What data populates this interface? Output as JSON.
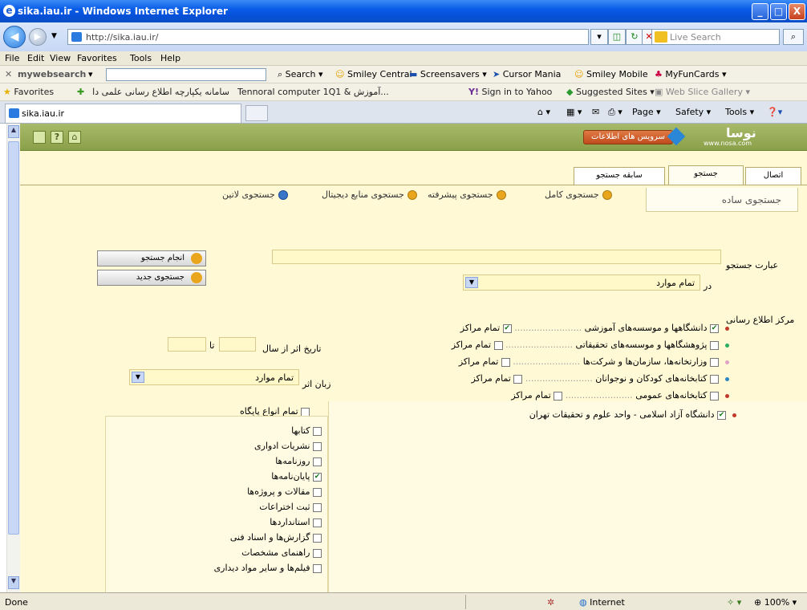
{
  "window": {
    "title": "sika.iau.ir - Windows Internet Explorer",
    "min": "_",
    "max": "□",
    "close": "X"
  },
  "address": {
    "url": "http://sika.iau.ir/",
    "search_placeholder": "Live Search"
  },
  "menu": [
    "File",
    "Edit",
    "View",
    "Favorites",
    "Tools",
    "Help"
  ],
  "mywebsearch": {
    "brand": "mywebsearch",
    "search": "Search",
    "items": [
      "Smiley Central",
      "Screensavers",
      "Cursor Mania",
      "Smiley Mobile",
      "MyFunCards"
    ]
  },
  "favbar": {
    "favorites": "Favorites",
    "items": [
      "سامانه یکپارچه اطلاع رسانی علمی دانشگاه آزاد",
      "Tennoral computer 1Q1 & آموزش...",
      "Sign in to Yahoo",
      "Suggested Sites",
      "Web Slice Gallery"
    ]
  },
  "tabbar": {
    "tab_title": "sika.iau.ir",
    "commands": [
      "Page",
      "Safety",
      "Tools"
    ]
  },
  "site": {
    "header_button": "سرویس های اطلاعات",
    "logo": "نوسا",
    "logo_url": "www.nosa.com"
  },
  "tabs": {
    "login": "اتصال",
    "search": "جستجو",
    "history": "سابقه جستجو"
  },
  "search_types": {
    "simple": "جستجوی ساده",
    "full": "جستجوی کامل",
    "advanced": "جستجوی پیشرفته",
    "digital": "جستجوی منابع دیجیتال",
    "latin": "جستجوی لاتین"
  },
  "form": {
    "query_label": "عبارت جستجو",
    "scope_label": "در",
    "scope_value": "تمام موارد",
    "submit": "انجام جستجو",
    "new_search": "جستجوی جدید",
    "year_label": "تاریخ اثر از سال",
    "year_to": "تا",
    "lang_label": "زبان اثر",
    "lang_value": "تمام موارد"
  },
  "centers": {
    "title": "مرکز اطلاع رسانی",
    "rows": [
      {
        "label": "دانشگاهها و موسسه‌های آموزشی",
        "all": "تمام مراکز",
        "checked": true,
        "color": "#c0392b"
      },
      {
        "label": "پژوهشگاهها و موسسه‌های تحقیقاتی",
        "all": "تمام مراکز",
        "checked": false,
        "color": "#27ae60"
      },
      {
        "label": "وزارتخانه‌ها، سازمان‌ها و شرکت‌ها",
        "all": "تمام مراکز",
        "checked": false,
        "color": "#e0a3c4"
      },
      {
        "label": "کتابخانه‌های کودکان و نوجوانان",
        "all": "تمام مراکز",
        "checked": false,
        "color": "#2e86c1"
      },
      {
        "label": "کتابخانه‌های عمومی",
        "all": "تمام مراکز",
        "checked": false,
        "color": "#c0392b"
      }
    ],
    "selected": "دانشگاه آزاد اسلامی - واحد علوم و تحقیقات تهران"
  },
  "doc_types": {
    "all": "تمام انواع پایگاه",
    "items": [
      {
        "label": "کتابها",
        "checked": false
      },
      {
        "label": "نشریات ادواری",
        "checked": false
      },
      {
        "label": "روزنامه‌ها",
        "checked": false
      },
      {
        "label": "پایان‌نامه‌ها",
        "checked": true
      },
      {
        "label": "مقالات و پروژه‌ها",
        "checked": false
      },
      {
        "label": "ثبت اختراعات",
        "checked": false
      },
      {
        "label": "استانداردها",
        "checked": false
      },
      {
        "label": "گزارش‌ها و اسناد فنی",
        "checked": false
      },
      {
        "label": "راهنمای مشخصات",
        "checked": false
      },
      {
        "label": "فیلم‌ها و سایر مواد دیداری",
        "checked": false
      }
    ]
  },
  "status": {
    "left": "Done",
    "zone": "Internet",
    "zoom": "100%"
  }
}
